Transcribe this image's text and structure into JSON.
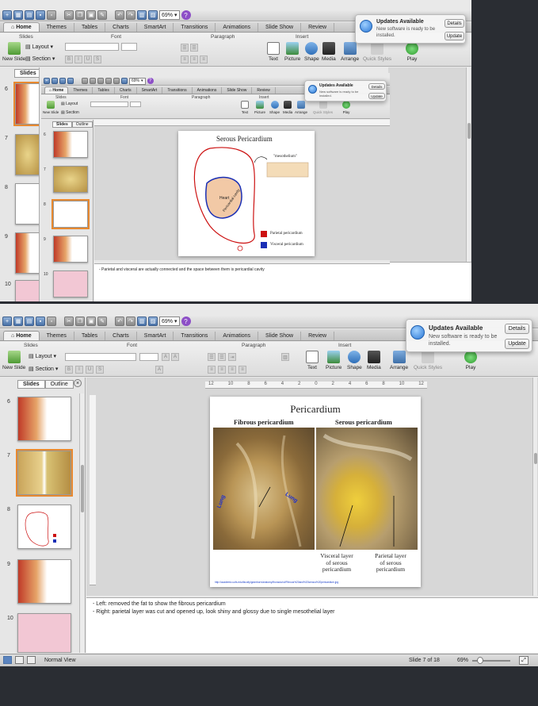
{
  "back_window": {
    "zoom": "69%",
    "tabs": [
      "Home",
      "Themes",
      "Tables",
      "Charts",
      "SmartArt",
      "Transitions",
      "Animations",
      "Slide Show",
      "Review"
    ],
    "groups": [
      "Slides",
      "Font",
      "Paragraph",
      "Insert"
    ],
    "ribbon": {
      "new_slide": "New Slide",
      "layout": "Layout",
      "section": "Section",
      "text": "Text",
      "picture": "Picture",
      "shape": "Shape",
      "media": "Media",
      "arrange": "Arrange",
      "quick_styles": "Quick Styles",
      "play": "Play"
    },
    "sidebar_tab": "Slides",
    "thumb_numbers": [
      "6",
      "7",
      "8",
      "9",
      "10"
    ]
  },
  "mid_window": {
    "zoom": "69%",
    "tabs": [
      "Home",
      "Themes",
      "Tables",
      "Charts",
      "SmartArt",
      "Transitions",
      "Animations",
      "Slide Show",
      "Review"
    ],
    "groups": [
      "Slides",
      "Font",
      "Paragraph",
      "Insert"
    ],
    "ribbon": {
      "new_slide": "New Slide",
      "layout": "Layout",
      "section": "Section",
      "text": "Text",
      "picture": "Picture",
      "shape": "Shape",
      "media": "Media",
      "arrange": "Arrange",
      "quick_styles": "Quick Styles",
      "play": "Play"
    },
    "sidebar_tabs": [
      "Slides",
      "Outline"
    ],
    "thumb_numbers": [
      "6",
      "7",
      "8",
      "9",
      "10"
    ],
    "slide": {
      "title": "Serous Pericardium",
      "mesothelium_label": "\"mesothelium\"",
      "heart_label": "Heart",
      "cavity_label": "Pericardial cavity",
      "legend": [
        {
          "label": "Parietal pericardium",
          "color": "#cc1111"
        },
        {
          "label": "Visceral pericardium",
          "color": "#1a2fb5"
        }
      ]
    },
    "notes": "- Parietal and visceral are actually connected and the space between them is pericardial cavity"
  },
  "notifications": [
    {
      "title": "Updates Available",
      "text": "New software is ready to be installed.",
      "details": "Details",
      "update": "Update"
    },
    {
      "title": "Updates Available",
      "text": "New software is ready to be installed.",
      "details": "Details",
      "update": "Update"
    },
    {
      "title": "Updates Available",
      "text": "New software is ready to be installed.",
      "details": "Details",
      "update": "Update"
    }
  ],
  "main_window": {
    "zoom": "69%",
    "tabs": [
      "Home",
      "Themes",
      "Tables",
      "Charts",
      "SmartArt",
      "Transitions",
      "Animations",
      "Slide Show",
      "Review"
    ],
    "groups": [
      "Slides",
      "Font",
      "Paragraph",
      "Insert"
    ],
    "ribbon": {
      "new_slide": "New Slide",
      "layout": "Layout",
      "section": "Section",
      "text": "Text",
      "picture": "Picture",
      "shape": "Shape",
      "media": "Media",
      "arrange": "Arrange",
      "quick_styles": "Quick Styles",
      "play": "Play"
    },
    "sidebar_tabs": [
      "Slides",
      "Outline"
    ],
    "thumb_numbers": [
      "6",
      "7",
      "8",
      "9",
      "10"
    ],
    "ruler_marks": [
      "12",
      "10",
      "8",
      "6",
      "4",
      "2",
      "0",
      "2",
      "4",
      "6",
      "8",
      "10",
      "12"
    ],
    "slide": {
      "title": "Pericardium",
      "left_heading": "Fibrous pericardium",
      "right_heading": "Serous pericardium",
      "lung_left": "Lung",
      "lung_right": "Lung",
      "visceral_label": "Visceral layer\nof serous\npericardium",
      "parietal_label": "Parietal layer\nof serous\npericardium",
      "source_url": "http://academic.uofs.edu/faculty/gramborn/anatomy/thoracic/cd/Fibrous%20and%20serous%20pericardium.jpg"
    },
    "notes": [
      "-  Left: removed the fat to show the fibrous pericardium",
      "-  Right: parietal layer was cut and opened up, look shiny and glossy due to single mesothelial layer"
    ],
    "status": {
      "view": "Normal View",
      "slide_counter": "Slide 7 of 18",
      "zoom": "69%"
    }
  }
}
